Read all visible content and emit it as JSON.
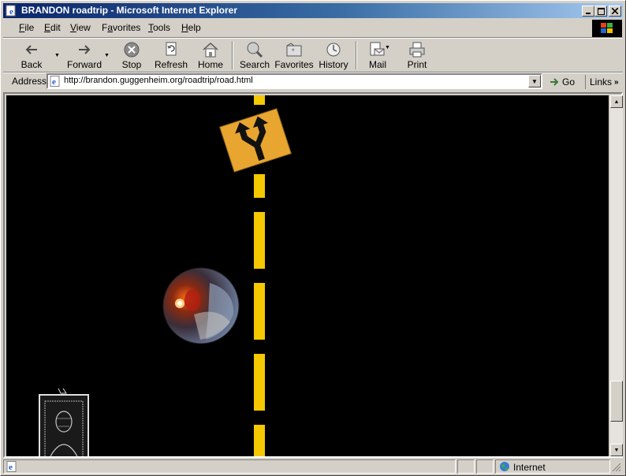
{
  "window": {
    "title": "BRANDON roadtrip - Microsoft Internet Explorer",
    "app_icon": "ie-page-icon",
    "controls": [
      "minimize-icon",
      "maximize-icon",
      "close-icon"
    ]
  },
  "menubar": {
    "items": [
      {
        "label": "File",
        "access": "F"
      },
      {
        "label": "Edit",
        "access": "E"
      },
      {
        "label": "View",
        "access": "V"
      },
      {
        "label": "Favorites",
        "access": "a"
      },
      {
        "label": "Tools",
        "access": "T"
      },
      {
        "label": "Help",
        "access": "H"
      }
    ]
  },
  "toolbar": {
    "back": "Back",
    "forward": "Forward",
    "stop": "Stop",
    "refresh": "Refresh",
    "home": "Home",
    "search": "Search",
    "favorites": "Favorites",
    "history": "History",
    "mail": "Mail",
    "print": "Print"
  },
  "addressbar": {
    "label": "Address",
    "url": "http://brandon.guggenheim.org/roadtrip/road.html",
    "go": "Go",
    "links": "Links"
  },
  "page": {
    "background": "#000000",
    "stripe_color": "#f5c800",
    "sign_color": "#e8a530",
    "items": [
      "divided-highway-sign",
      "round-dashboard-photo",
      "framed-portrait"
    ]
  },
  "statusbar": {
    "zone": "Internet"
  },
  "colors": {
    "chrome": "#d4d0c8",
    "title_start": "#0a246a",
    "title_end": "#a6caf0"
  }
}
